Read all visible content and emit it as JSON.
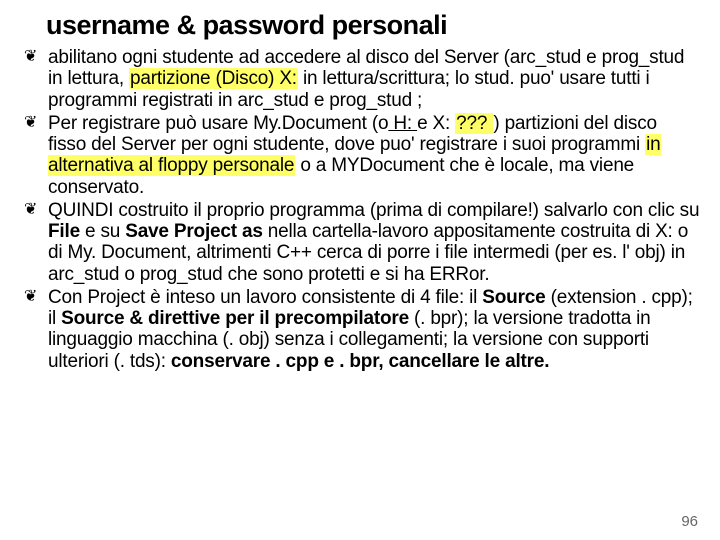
{
  "title": "username & password personali",
  "items": [
    {
      "pre": "abilitano ogni studente ad accedere al disco del Server (arc_stud e prog_stud in lettura, ",
      "hl1": "partizione (Disco) X:",
      "post": " in lettura/scrittura; lo stud. puo' usare tutti i programmi registrati in arc_stud e prog_stud ;"
    },
    {
      "pre": "Per registrare può usare My.Document (o",
      "uh": " H: ",
      "mid": "e X: ",
      "hl1": "??? ",
      "mid2": ") partizioni del disco fisso del Server per ogni studente, dove puo' registrare i suoi programmi ",
      "hl2": "in alternativa al floppy personale",
      "post": " o a MYDocument che è locale, ma viene conservato."
    },
    {
      "pre": "QUINDI costruito il proprio programma (prima di compilare!) salvarlo con clic su ",
      "b1": "File",
      "mid": " e su ",
      "b2": "Save Project as",
      "post": " nella cartella-lavoro appositamente costruita di X: o di  My. Document, altrimenti C++  cerca di porre i file intermedi (per es. l' obj) in arc_stud o prog_stud che sono protetti e si ha ERRor."
    },
    {
      "pre": "Con Project è inteso un lavoro consistente di 4 file: il ",
      "b1": "Source",
      "mid": " (extension . cpp); il ",
      "b2": "Source & direttive per il precompilatore",
      "mid2": " (. bpr); la versione tradotta in linguaggio macchina (. obj) senza i collegamenti; la versione con supporti ulteriori (. tds): ",
      "b3": "conservare . cpp e . bpr, cancellare le altre."
    }
  ],
  "pagenum": "96"
}
